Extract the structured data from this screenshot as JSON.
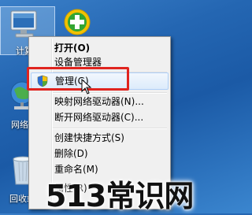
{
  "desktop": {
    "icons": [
      {
        "label": "计算机",
        "visible_label": "计算"
      },
      {
        "label": "网络",
        "visible_label": "网络"
      },
      {
        "label": "回收站",
        "visible_label": "回收站"
      }
    ]
  },
  "context_menu": {
    "items": [
      {
        "label": "打开(O)",
        "bold": true
      },
      {
        "label": "设备管理器"
      },
      {
        "label": "管理(G)",
        "highlighted": true
      },
      {
        "label": "映射网络驱动器(N)..."
      },
      {
        "label": "断开网络驱动器(C)..."
      },
      {
        "label": "创建快捷方式(S)"
      },
      {
        "label": "删除(D)"
      },
      {
        "label": "重命名(M)"
      },
      {
        "label": "属性(R)"
      }
    ]
  },
  "watermark": {
    "text": "513常识网"
  },
  "colors": {
    "highlight_box": "#e0241f",
    "desktop": "#1b5aa6",
    "menu_bg": "#f0f0f0"
  }
}
